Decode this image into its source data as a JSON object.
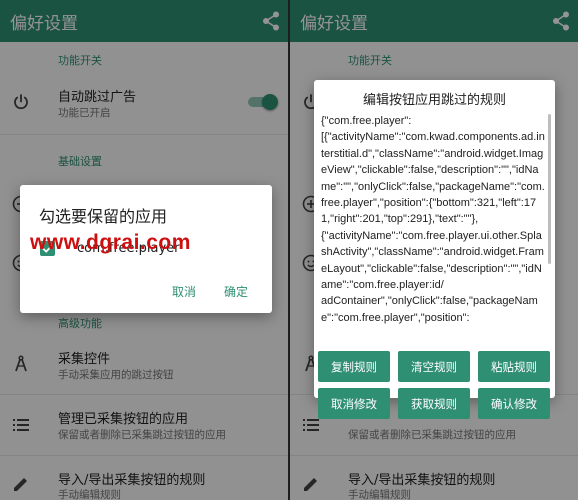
{
  "app": {
    "title": "偏好设置"
  },
  "sections": {
    "feature_switch": "功能开关",
    "basic_settings": "基础设置",
    "advanced": "高级功能"
  },
  "settings": {
    "auto_skip": {
      "title": "自动跳过广告",
      "subtitle": "功能已开启",
      "enabled": true
    },
    "collect": {
      "title": "采集控件",
      "subtitle": "手动采集应用的跳过按钮"
    },
    "manage": {
      "title": "管理已采集按钮的应用",
      "subtitle": "保留或者删除已采集跳过按钮的应用"
    },
    "import_export": {
      "title": "导入/导出采集按钮的规则",
      "subtitle": "手动编辑规则"
    }
  },
  "select_dialog": {
    "title": "勾选要保留的应用",
    "item_label": "com.free.player",
    "item_checked": true,
    "cancel": "取消",
    "confirm": "确定"
  },
  "watermark": "www.dgrai.com",
  "rule_dialog": {
    "title": "编辑按钮应用跳过的规则",
    "content": "{\"com.free.player\":\n[{\"activityName\":\"com.kwad.components.ad.interstitial.d\",\"className\":\"android.widget.ImageView\",\"clickable\":false,\"description\":\"\",\"idName\":\"\",\"onlyClick\":false,\"packageName\":\"com.free.player\",\"position\":{\"bottom\":321,\"left\":171,\"right\":201,\"top\":291},\"text\":\"\"},\n{\"activityName\":\"com.free.player.ui.other.SplashActivity\",\"className\":\"android.widget.FrameLayout\",\"clickable\":false,\"description\":\"\",\"idName\":\"com.free.player:id/\nadContainer\",\"onlyClick\":false,\"packageName\":\"com.free.player\",\"position\":",
    "buttons": {
      "copy": "复制规则",
      "clear": "清空规则",
      "paste": "粘贴规则",
      "cancel": "取消修改",
      "fetch": "获取规则",
      "confirm": "确认修改"
    }
  },
  "colors": {
    "primary": "#2f8f73",
    "watermark": "#cc1010"
  }
}
